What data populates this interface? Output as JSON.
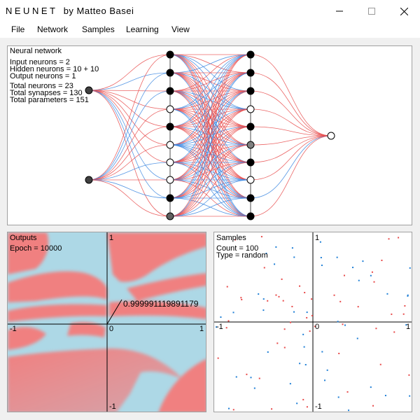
{
  "window": {
    "app_name": "NEUNET",
    "byline": "by Matteo Basei",
    "minimize_icon": "minimize-icon",
    "maximize_icon": "maximize-icon",
    "close_icon": "close-icon"
  },
  "menu": [
    "File",
    "Network",
    "Samples",
    "Learning",
    "View"
  ],
  "network": {
    "title": "Neural network",
    "stats": [
      "Input neurons = 2",
      "Hidden neurons = 10 + 10",
      "Output neurons = 1",
      "Total neurons = 23",
      "Total synapses = 130",
      "Total parameters = 151"
    ],
    "colors": {
      "positive": "#e84a4a",
      "negative": "#3a86e0"
    },
    "layers": [
      [
        "#404040",
        "#404040"
      ],
      [
        "#000",
        "#000",
        "#000",
        "#fff",
        "#000",
        "#fff",
        "#fff",
        "#fff",
        "#000",
        "#606060"
      ],
      [
        "#000",
        "#000",
        "#000",
        "#fff",
        "#000",
        "#808080",
        "#000",
        "#fff",
        "#000",
        "#000"
      ],
      [
        "#fff"
      ]
    ]
  },
  "outputs": {
    "title": "Outputs",
    "epoch": "Epoch = 10000",
    "tick_top": "1",
    "tick_bottom": "-1",
    "tick_left": "-1",
    "tick_right": "1",
    "tick_origin": "0",
    "probe_value": "0.999991119891179",
    "colors": {
      "high": "#add8e6",
      "low": "#f08080"
    }
  },
  "samples": {
    "title": "Samples",
    "count": "Count = 100",
    "type": "Type = random",
    "ticks": {
      "l_top": "1",
      "l_left": "-1",
      "l_bottom": "-1",
      "r_origin": "0",
      "r_right": "1"
    },
    "colors": {
      "red": "#e84a4a",
      "blue": "#1f7fd6"
    }
  }
}
